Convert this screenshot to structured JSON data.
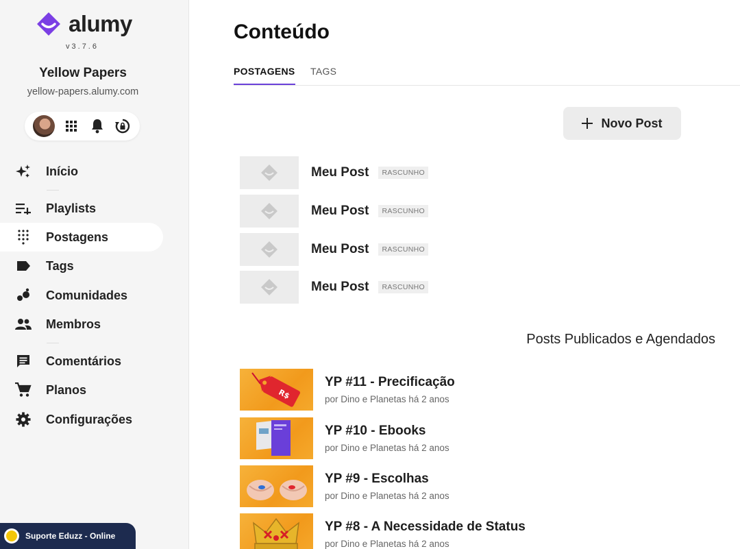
{
  "brand": {
    "name": "alumy",
    "version": "v3.7.6",
    "color": "#7b3fe4"
  },
  "org": {
    "name": "Yellow Papers",
    "url": "yellow-papers.alumy.com"
  },
  "toolbar": {
    "icons": [
      "avatar",
      "apps-grid-icon",
      "bell-icon",
      "sync-lock-icon"
    ]
  },
  "nav": {
    "items": [
      {
        "label": "Início",
        "icon": "sparkle-icon"
      },
      {
        "label": "Playlists",
        "icon": "playlist-add-icon"
      },
      {
        "label": "Postagens",
        "icon": "dots-grid-icon",
        "active": true
      },
      {
        "label": "Tags",
        "icon": "tag-icon"
      },
      {
        "label": "Comunidades",
        "icon": "bubbles-icon"
      },
      {
        "label": "Membros",
        "icon": "people-icon"
      },
      {
        "label": "Comentários",
        "icon": "comment-icon"
      },
      {
        "label": "Planos",
        "icon": "cart-icon"
      },
      {
        "label": "Configurações",
        "icon": "gear-icon"
      }
    ]
  },
  "support": {
    "label": "Suporte Eduzz - Online"
  },
  "main": {
    "title": "Conteúdo",
    "tabs": [
      {
        "label": "POSTAGENS",
        "active": true
      },
      {
        "label": "TAGS"
      }
    ],
    "new_post_label": "Novo Post",
    "drafts": [
      {
        "title": "Meu Post",
        "badge": "RASCUNHO"
      },
      {
        "title": "Meu Post",
        "badge": "RASCUNHO"
      },
      {
        "title": "Meu Post",
        "badge": "RASCUNHO"
      },
      {
        "title": "Meu Post",
        "badge": "RASCUNHO"
      }
    ],
    "published_title": "Posts Publicados e Agendados",
    "published": [
      {
        "title": "YP #11 - Precificação",
        "meta": "por Dino e Planetas há 2 anos",
        "thumb": "price-tag"
      },
      {
        "title": "YP #10 - Ebooks",
        "meta": "por Dino e Planetas há 2 anos",
        "thumb": "ebook"
      },
      {
        "title": "YP #9 - Escolhas",
        "meta": "por Dino e Planetas há 2 anos",
        "thumb": "pills"
      },
      {
        "title": "YP #8 - A Necessidade de Status",
        "meta": "por Dino e Planetas há 2 anos",
        "thumb": "crown"
      }
    ]
  }
}
